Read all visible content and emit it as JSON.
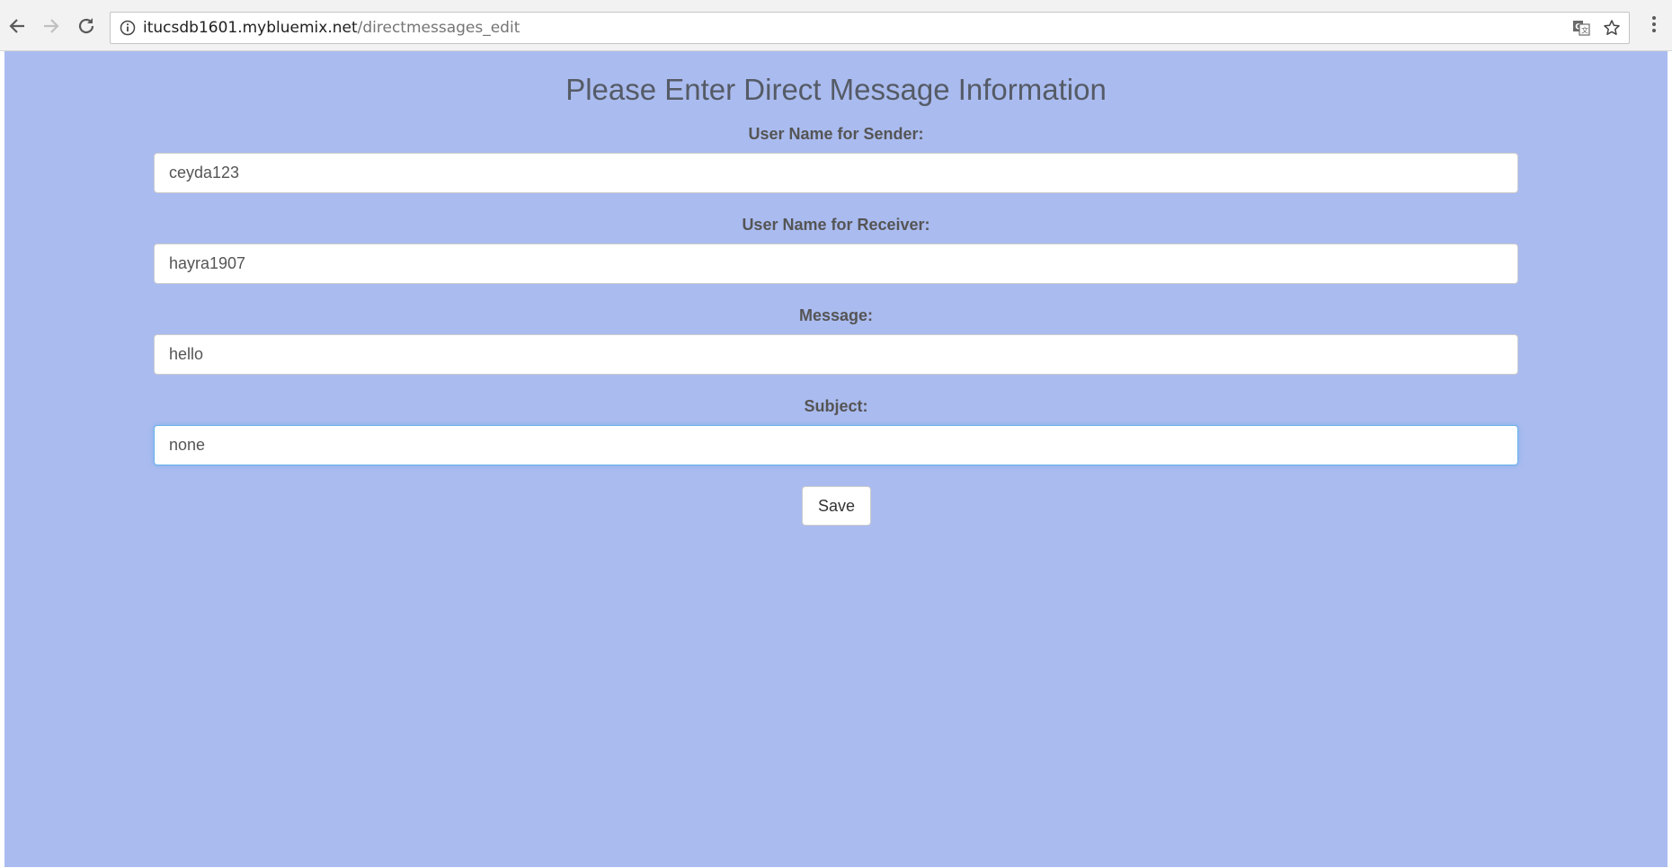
{
  "browser": {
    "url_host": "itucsdb1601.mybluemix.net",
    "url_path": "/directmessages_edit",
    "icons": [
      "back-arrow-icon",
      "forward-arrow-icon",
      "reload-icon",
      "info-icon",
      "translate-icon",
      "star-icon",
      "kebab-menu-icon"
    ]
  },
  "page": {
    "title": "Please Enter Direct Message Information",
    "background": "#aabbef",
    "fields": [
      {
        "label": "User Name for Sender:",
        "value": "ceyda123"
      },
      {
        "label": "User Name for Receiver:",
        "value": "hayra1907"
      },
      {
        "label": "Message:",
        "value": "hello"
      },
      {
        "label": "Subject:",
        "value": "none"
      }
    ],
    "save_label": "Save"
  }
}
